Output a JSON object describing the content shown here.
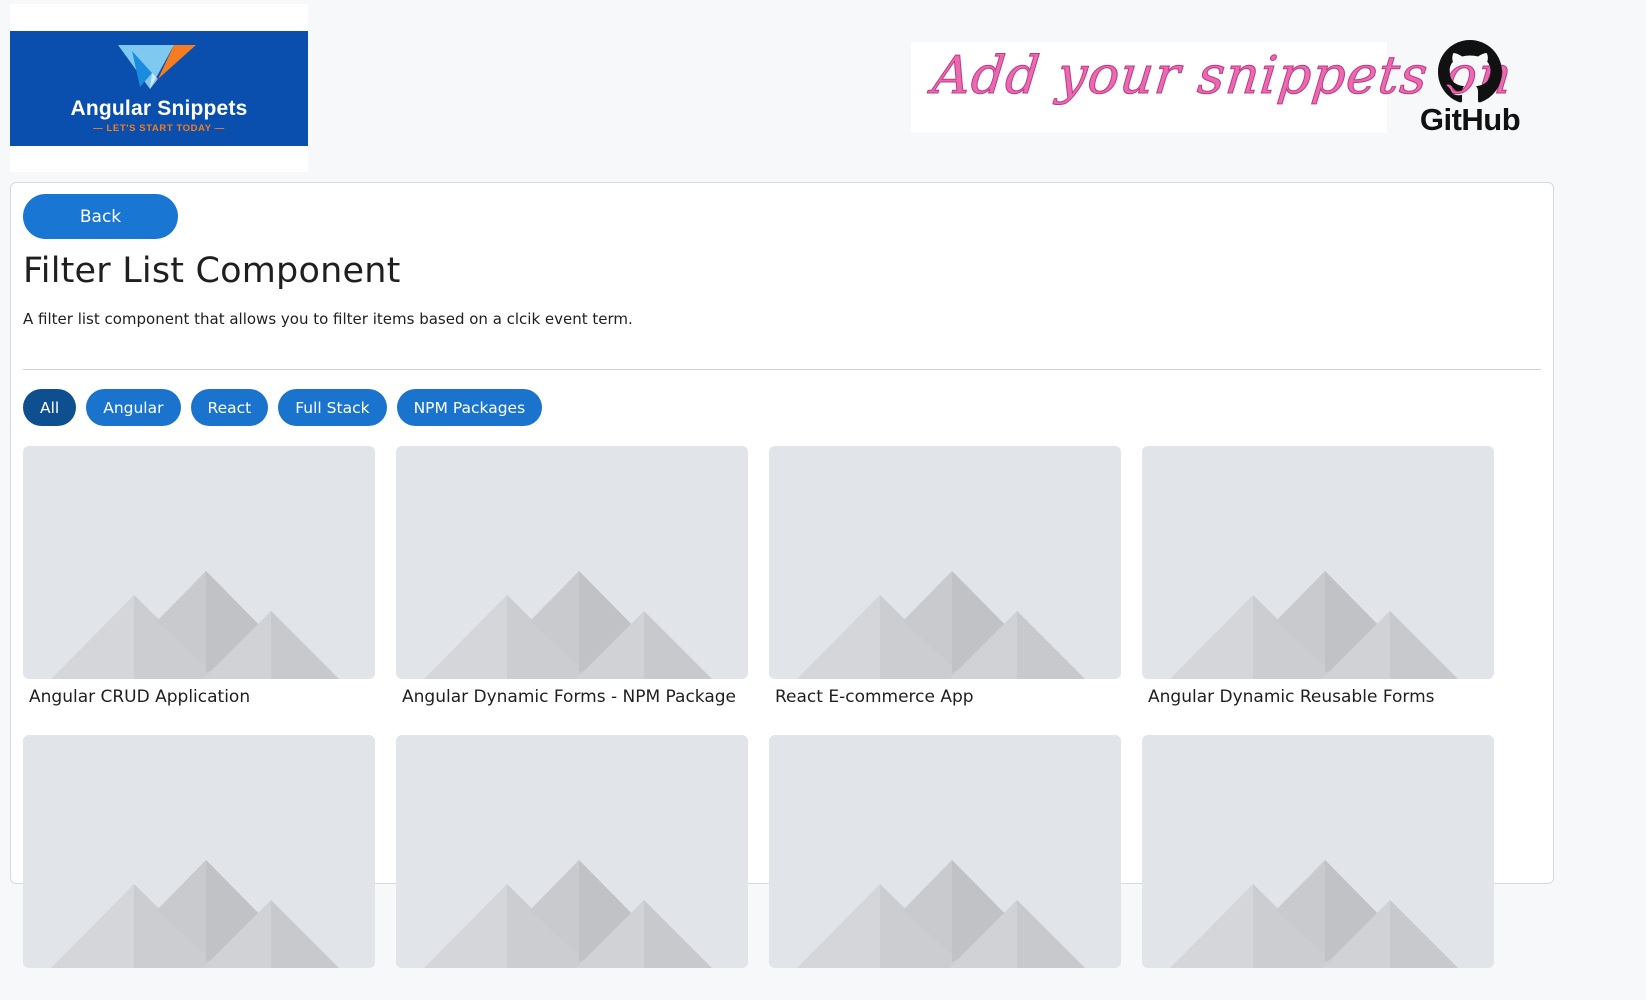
{
  "header": {
    "logo_title": "Angular Snippets",
    "logo_tagline": "— LET'S START TODAY —",
    "promo_text": "Add your snippets on",
    "github_label": "GitHub"
  },
  "page": {
    "back_label": "Back",
    "title": "Filter List Component",
    "description": "A filter list component that allows you to filter items based on a clcik event term."
  },
  "filters": [
    {
      "label": "All",
      "active": true
    },
    {
      "label": "Angular",
      "active": false
    },
    {
      "label": "React",
      "active": false
    },
    {
      "label": "Full Stack",
      "active": false
    },
    {
      "label": "NPM Packages",
      "active": false
    }
  ],
  "items": [
    {
      "title": "Angular CRUD Application"
    },
    {
      "title": "Angular Dynamic Forms - NPM Package"
    },
    {
      "title": "React E-commerce App"
    },
    {
      "title": "Angular Dynamic Reusable Forms"
    },
    {
      "title": ""
    },
    {
      "title": ""
    },
    {
      "title": ""
    },
    {
      "title": ""
    }
  ],
  "colors": {
    "primary": "#1976d2",
    "chip": "#1a73cc",
    "chip_active": "#0d4f8f",
    "placeholder": "#e1e4e8",
    "logo_bg": "#0a4fad",
    "promo_pink": "#e86ab3"
  },
  "icons": {
    "logo": "paper-plane-logo-icon",
    "github": "github-octocat-icon",
    "placeholder": "image-placeholder-icon"
  }
}
